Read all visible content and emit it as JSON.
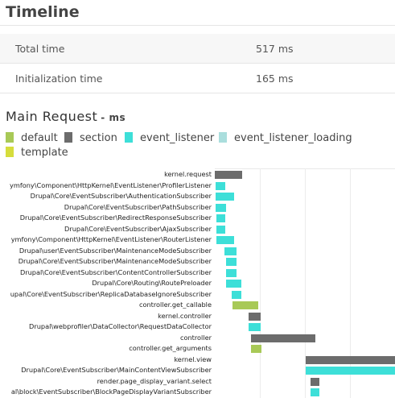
{
  "header": {
    "title": "Timeline"
  },
  "summary": [
    {
      "label": "Total time",
      "value": "517 ms"
    },
    {
      "label": "Initialization time",
      "value": "165 ms"
    }
  ],
  "main": {
    "title": "Main Request",
    "unit": "- ms"
  },
  "colors": {
    "default": "#a8c957",
    "section": "#6c6c6c",
    "event_listener": "#3ddfd8",
    "event_listener_loading": "#aadedd",
    "template": "#d6dd3c"
  },
  "legend": [
    {
      "key": "default",
      "label": "default"
    },
    {
      "key": "section",
      "label": "section"
    },
    {
      "key": "event_listener",
      "label": "event_listener"
    },
    {
      "key": "event_listener_loading",
      "label": "event_listener_loading"
    },
    {
      "key": "template",
      "label": "template"
    }
  ],
  "events": [
    {
      "label": "kernel.request",
      "type": "section",
      "start": 0,
      "end": 110
    },
    {
      "label": "ymfony\\Component\\HttpKernel\\EventListener\\ProfilerListener",
      "type": "event_listener",
      "start": 2,
      "end": 42
    },
    {
      "label": "Drupal\\Core\\EventSubscriber\\AuthenticationSubscriber",
      "type": "event_listener",
      "start": 2,
      "end": 77
    },
    {
      "label": "Drupal\\Core\\EventSubscriber\\PathSubscriber",
      "type": "event_listener",
      "start": 2,
      "end": 45
    },
    {
      "label": "Drupal\\Core\\EventSubscriber\\RedirectResponseSubscriber",
      "type": "event_listener",
      "start": 7,
      "end": 43
    },
    {
      "label": "Drupal\\Core\\EventSubscriber\\AjaxSubscriber",
      "type": "event_listener",
      "start": 7,
      "end": 43
    },
    {
      "label": "ymfony\\Component\\HttpKernel\\EventListener\\RouterListener",
      "type": "event_listener",
      "start": 7,
      "end": 77
    },
    {
      "label": "Drupal\\user\\EventSubscriber\\MaintenanceModeSubscriber",
      "type": "event_listener",
      "start": 40,
      "end": 86
    },
    {
      "label": "Drupal\\Core\\EventSubscriber\\MaintenanceModeSubscriber",
      "type": "event_listener",
      "start": 45,
      "end": 88
    },
    {
      "label": "Drupal\\Core\\EventSubscriber\\ContentControllerSubscriber",
      "type": "event_listener",
      "start": 45,
      "end": 86
    },
    {
      "label": "Drupal\\Core\\Routing\\RoutePreloader",
      "type": "event_listener",
      "start": 45,
      "end": 107
    },
    {
      "label": "upal\\Core\\EventSubscriber\\ReplicaDatabaseIgnoreSubscriber",
      "type": "event_listener",
      "start": 68,
      "end": 107
    },
    {
      "label": "controller.get_callable",
      "type": "default",
      "start": 71,
      "end": 172
    },
    {
      "label": "kernel.controller",
      "type": "section",
      "start": 136,
      "end": 184
    },
    {
      "label": "Drupal\\webprofiler\\DataCollector\\RequestDataCollector",
      "type": "event_listener",
      "start": 136,
      "end": 184
    },
    {
      "label": "controller",
      "type": "section",
      "start": 144,
      "end": 401
    },
    {
      "label": "controller.get_arguments",
      "type": "default",
      "start": 144,
      "end": 186
    },
    {
      "label": "kernel.view",
      "type": "section",
      "start": 364,
      "end": 794
    },
    {
      "label": "Drupal\\Core\\EventSubscriber\\MainContentViewSubscriber",
      "type": "event_listener",
      "start": 364,
      "end": 794
    },
    {
      "label": "render.page_display_variant.select",
      "type": "section",
      "start": 381,
      "end": 417
    },
    {
      "label": "al\\block\\EventSubscriber\\BlockPageDisplayVariantSubscriber",
      "type": "event_listener",
      "start": 381,
      "end": 417
    }
  ]
}
